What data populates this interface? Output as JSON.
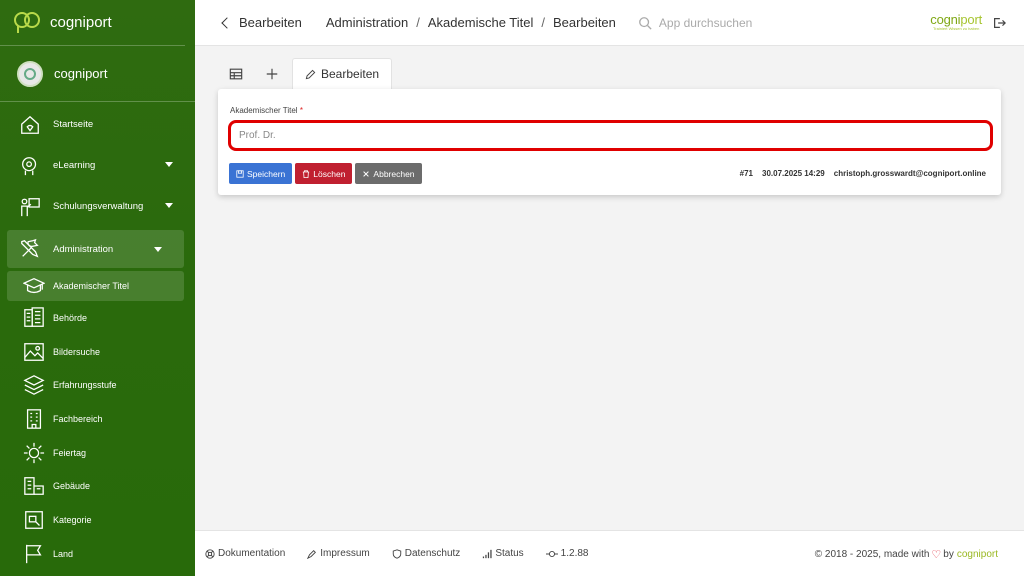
{
  "sidebar": {
    "brand": "cogniport",
    "org": "cogniport",
    "items": [
      {
        "label": "Startseite",
        "icon": "home-icon"
      },
      {
        "label": "eLearning",
        "icon": "elearning-icon",
        "expandable": true
      },
      {
        "label": "Schulungsverwaltung",
        "icon": "training-icon",
        "expandable": true
      },
      {
        "label": "Administration",
        "icon": "tools-icon",
        "expandable": true,
        "active": true
      }
    ],
    "subitems": [
      {
        "label": "Akademischer Titel",
        "icon": "graduation-cap-icon",
        "active": true
      },
      {
        "label": "Behörde",
        "icon": "building-icon"
      },
      {
        "label": "Bildersuche",
        "icon": "image-icon"
      },
      {
        "label": "Erfahrungsstufe",
        "icon": "layers-icon"
      },
      {
        "label": "Fachbereich",
        "icon": "office-icon"
      },
      {
        "label": "Feiertag",
        "icon": "sun-icon"
      },
      {
        "label": "Gebäude",
        "icon": "buildings-icon"
      },
      {
        "label": "Kategorie",
        "icon": "category-icon"
      },
      {
        "label": "Land",
        "icon": "flag-icon"
      }
    ]
  },
  "header": {
    "back_label": "Bearbeiten",
    "breadcrumbs": [
      "Administration",
      "Akademische Titel",
      "Bearbeiten"
    ],
    "search_placeholder": "App durchsuchen",
    "brand_main": "cogni",
    "brand_accent": "port",
    "brand_tagline": "Trainiert Wissen zu haben"
  },
  "tabs": {
    "active_label": "Bearbeiten"
  },
  "form": {
    "field_label": "Akademischer Titel",
    "required_mark": "*",
    "field_value": "Prof. Dr.",
    "save_label": "Speichern",
    "delete_label": "Löschen",
    "cancel_label": "Abbrechen",
    "record_id": "#71",
    "timestamp": "30.07.2025 14:29",
    "user": "christoph.grosswardt@cogniport.online"
  },
  "footer": {
    "documentation": "Dokumentation",
    "imprint": "Impressum",
    "privacy": "Datenschutz",
    "status": "Status",
    "version": "1.2.88",
    "copyright": "© 2018 - 2025, made with",
    "by": "by",
    "brand": "cogniport"
  },
  "colors": {
    "sidebar": "#2a6a0c",
    "save": "#3a73d4",
    "delete": "#c02030",
    "cancel": "#6c6c6c",
    "highlight": "#e00000",
    "brand_green": "#9ab822"
  }
}
